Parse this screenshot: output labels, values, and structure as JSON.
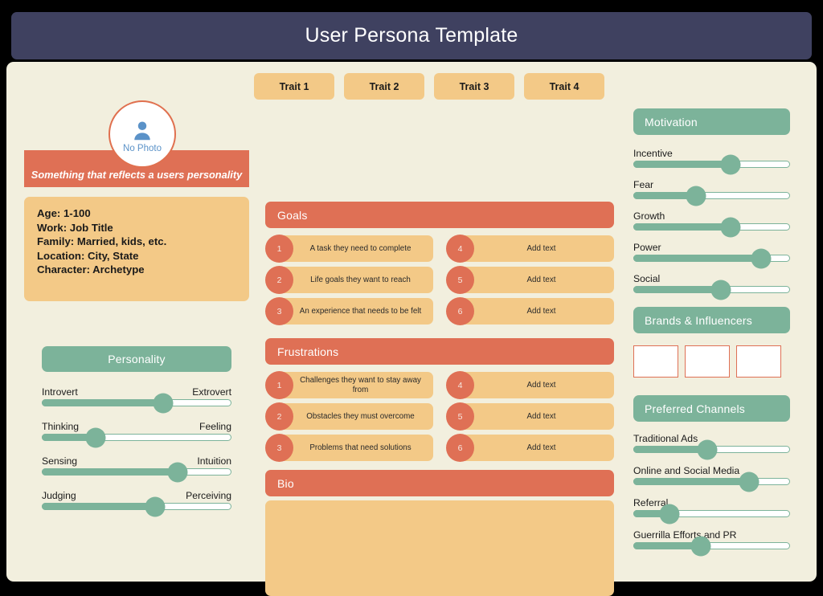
{
  "header": {
    "title": "User Persona Template"
  },
  "traits": [
    {
      "label": "Trait 1"
    },
    {
      "label": "Trait 2"
    },
    {
      "label": "Trait 3"
    },
    {
      "label": "Trait 4"
    }
  ],
  "profile": {
    "avatar_label": "No Photo",
    "avatar_icon": "person-icon",
    "tagline": "Something that reflects a users personality",
    "details": [
      "Age: 1-100",
      "Work: Job Title",
      "Family: Married, kids, etc.",
      "Location: City, State",
      "Character: Archetype"
    ]
  },
  "personality": {
    "title": "Personality",
    "sliders": [
      {
        "left": "Introvert",
        "right": "Extrovert",
        "value": 64
      },
      {
        "left": "Thinking",
        "right": "Feeling",
        "value": 28
      },
      {
        "left": "Sensing",
        "right": "Intuition",
        "value": 72
      },
      {
        "left": "Judging",
        "right": "Perceiving",
        "value": 60
      }
    ]
  },
  "goals": {
    "title": "Goals",
    "left_items": [
      {
        "num": "1",
        "text": "A task they need to complete"
      },
      {
        "num": "2",
        "text": "Life goals they want to reach"
      },
      {
        "num": "3",
        "text": "An experience that needs to be felt"
      }
    ],
    "right_items": [
      {
        "num": "4",
        "text": "Add text"
      },
      {
        "num": "5",
        "text": "Add text"
      },
      {
        "num": "6",
        "text": "Add text"
      }
    ]
  },
  "frustrations": {
    "title": "Frustrations",
    "left_items": [
      {
        "num": "1",
        "text": "Challenges they want to stay away from"
      },
      {
        "num": "2",
        "text": "Obstacles they must overcome"
      },
      {
        "num": "3",
        "text": "Problems that need solutions"
      }
    ],
    "right_items": [
      {
        "num": "4",
        "text": "Add text"
      },
      {
        "num": "5",
        "text": "Add text"
      },
      {
        "num": "6",
        "text": "Add text"
      }
    ]
  },
  "bio": {
    "title": "Bio",
    "content": ""
  },
  "motivation": {
    "title": "Motivation",
    "sliders": [
      {
        "label": "Incentive",
        "value": 62
      },
      {
        "label": "Fear",
        "value": 40
      },
      {
        "label": "Growth",
        "value": 62
      },
      {
        "label": "Power",
        "value": 82
      },
      {
        "label": "Social",
        "value": 56
      }
    ]
  },
  "brands": {
    "title": "Brands & Influencers",
    "boxes": [
      {},
      {},
      {}
    ]
  },
  "channels": {
    "title": "Preferred Channels",
    "sliders": [
      {
        "label": "Traditional Ads",
        "value": 47
      },
      {
        "label": "Online and Social Media",
        "value": 74
      },
      {
        "label": "Referral",
        "value": 23
      },
      {
        "label": "Guerrilla Efforts and PR",
        "value": 43
      }
    ]
  },
  "colors": {
    "header_navy": "#3F4160",
    "canvas_cream": "#F2EFDE",
    "coral": "#DF7055",
    "sand": "#F3C987",
    "green": "#7CB39A",
    "avatar_blue": "#5B92C8"
  }
}
